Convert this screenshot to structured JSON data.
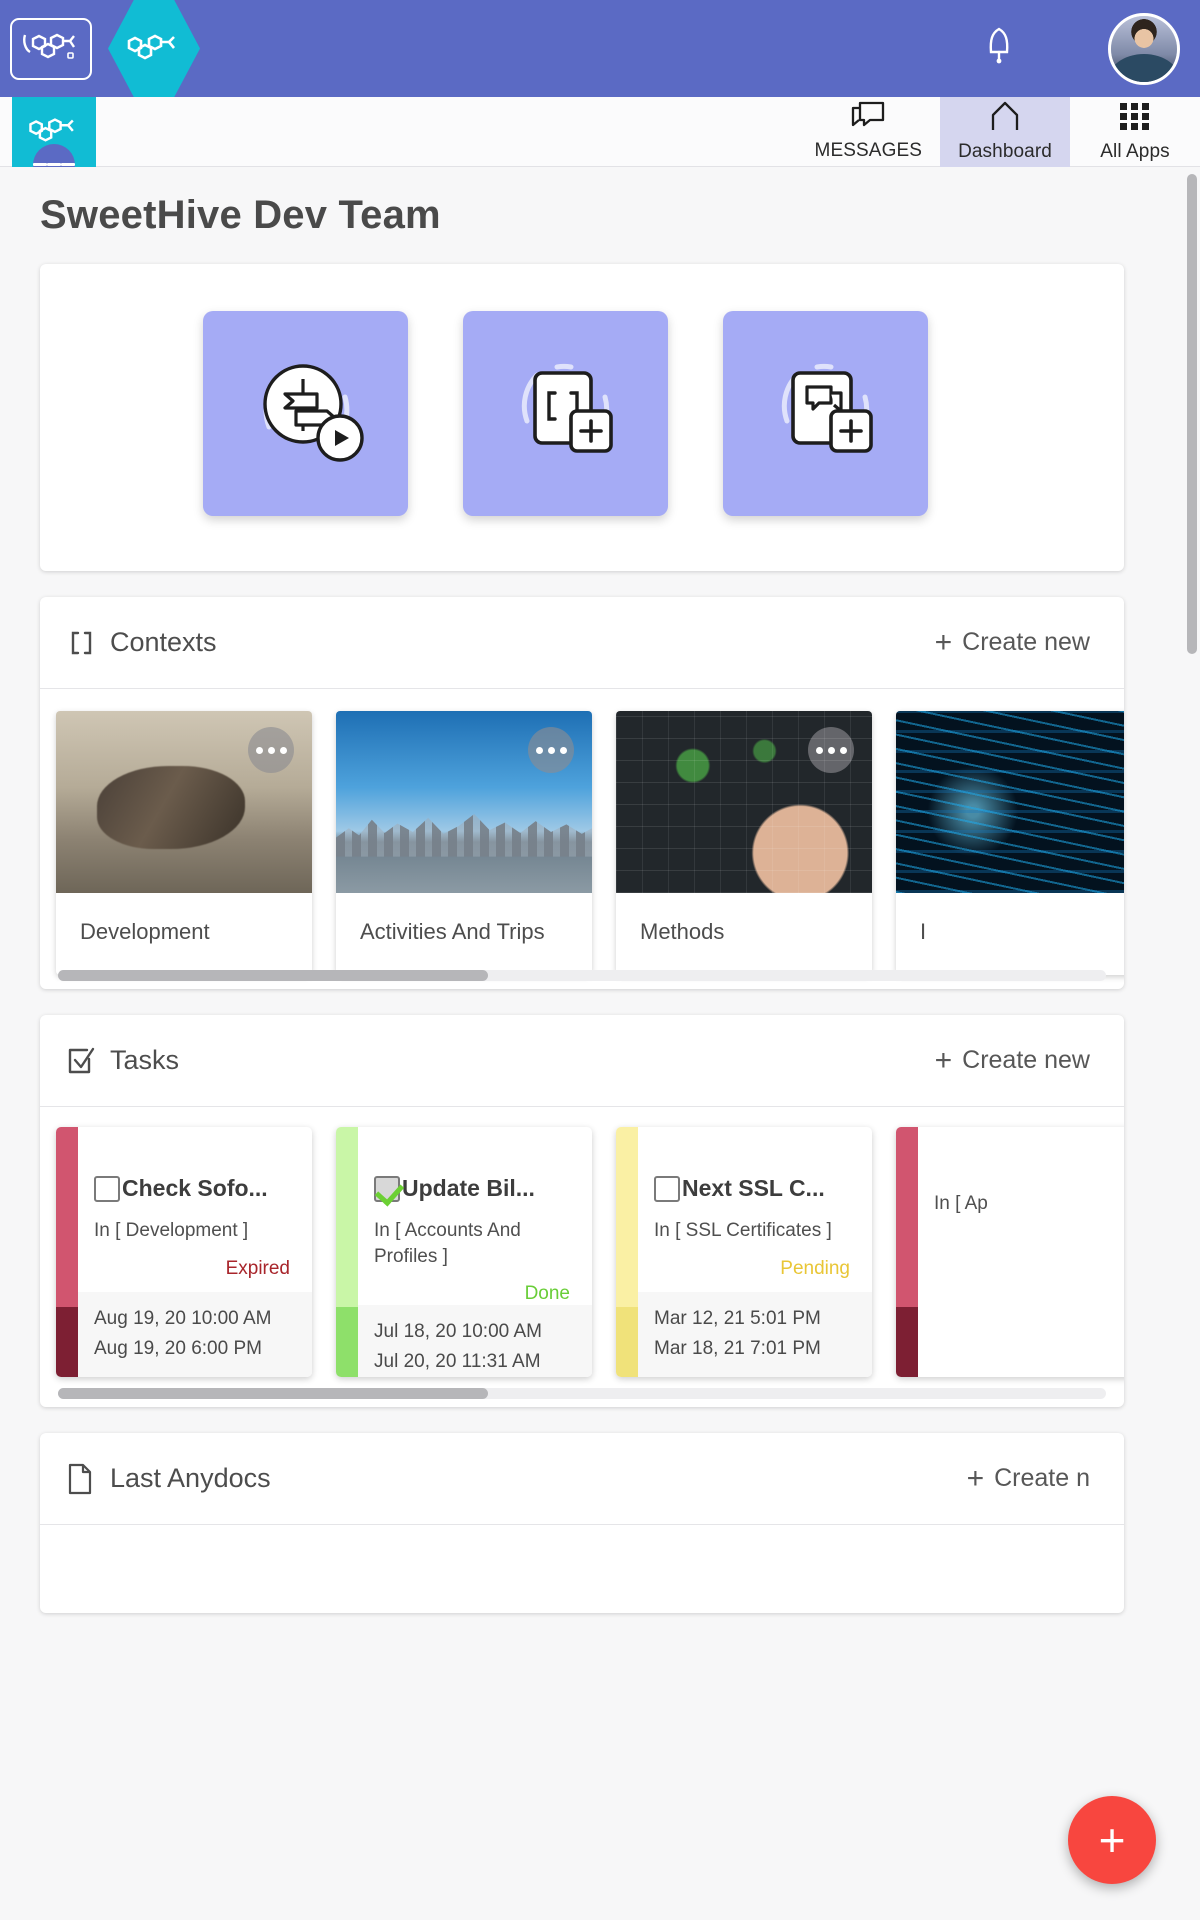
{
  "topbar": {
    "brand_icon": "molecule-logo-icon",
    "hex_logo_icon": "hexagon-molecule-logo-icon",
    "notifications_icon": "bell-icon",
    "avatar_icon": "user-avatar"
  },
  "navbar": {
    "app_logo_icon": "app-logo-icon",
    "menu_icon": "hamburger-menu-icon",
    "items": [
      {
        "label": "MESSAGES",
        "icon": "messages-icon",
        "active": false
      },
      {
        "label": "Dashboard",
        "icon": "home-icon",
        "active": true
      },
      {
        "label": "All Apps",
        "icon": "grid-apps-icon",
        "active": false
      }
    ]
  },
  "page": {
    "title": "SweetHive Dev Team"
  },
  "quick_actions": {
    "tiles": [
      {
        "icon": "signpost-play-icon",
        "name": "tour-tile"
      },
      {
        "icon": "context-add-icon",
        "name": "create-context-tile"
      },
      {
        "icon": "message-add-icon",
        "name": "create-message-tile"
      }
    ]
  },
  "contexts_section": {
    "icon": "brackets-icon",
    "title": "Contexts",
    "create_label": "Create new",
    "plus": "+",
    "menu_icon": "more-options-icon",
    "cards": [
      {
        "name": "Development",
        "image": "img-dev"
      },
      {
        "name": "Activities And Trips",
        "image": "img-city"
      },
      {
        "name": "Methods",
        "image": "img-board"
      },
      {
        "name": "I",
        "image": "img-code"
      }
    ],
    "scroll_percent": 41
  },
  "tasks_section": {
    "icon": "checkbox-task-icon",
    "title": "Tasks",
    "create_label": "Create new",
    "plus": "+",
    "cards": [
      {
        "title": "Check Sofo...",
        "checked": false,
        "context": "In [ Development ]",
        "status": "Expired",
        "status_color": "#a8252b",
        "bar_top_color": "#d1556f",
        "bar_bottom_color": "#7d1f33",
        "date_start": "Aug 19, 20 10:00 AM",
        "date_end": "Aug 19, 20 6:00 PM"
      },
      {
        "title": "Update Bil...",
        "checked": true,
        "context": "In [ Accounts And Profiles ]",
        "status": "Done",
        "status_color": "#69cd38",
        "bar_top_color": "#c9f6a7",
        "bar_bottom_color": "#8ee06a",
        "date_start": "Jul 18, 20 10:00 AM",
        "date_end": "Jul 20, 20 11:31 AM"
      },
      {
        "title": "Next SSL C...",
        "checked": false,
        "context": "In [ SSL Certificates ]",
        "status": "Pending",
        "status_color": "#e9c636",
        "bar_top_color": "#faf0a4",
        "bar_bottom_color": "#f0e27a",
        "date_start": "Mar 12, 21 5:01 PM",
        "date_end": "Mar 18, 21 7:01 PM"
      },
      {
        "title": "",
        "checked": false,
        "context": "In [ Ap",
        "status": "",
        "status_color": "#a8252b",
        "bar_top_color": "#d1556f",
        "bar_bottom_color": "#7d1f33",
        "date_start": "",
        "date_end": ""
      }
    ],
    "scroll_percent": 41
  },
  "anydocs_section": {
    "icon": "document-icon",
    "title": "Last Anydocs",
    "create_label": "Create n",
    "plus": "+"
  },
  "fab": {
    "label": "+",
    "color": "#f8463f",
    "name": "add-button"
  },
  "colors": {
    "topbar": "#5b6ac4",
    "accent_cyan": "#11bcd4",
    "tile_purple": "#a5abf5",
    "fab_red": "#f8463f"
  }
}
